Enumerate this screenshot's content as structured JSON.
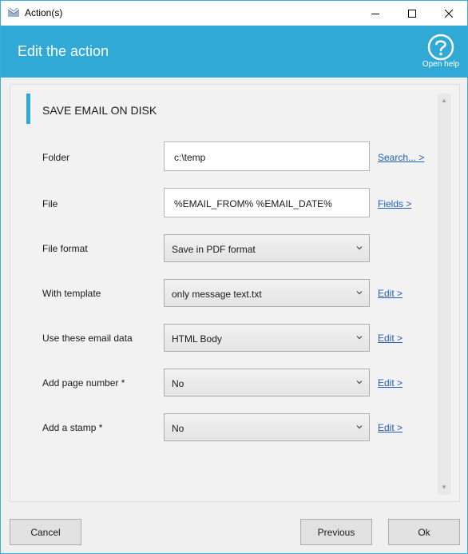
{
  "window": {
    "title": "Action(s)"
  },
  "header": {
    "title": "Edit the action",
    "help_label": "Open help"
  },
  "section": {
    "title": "SAVE EMAIL ON DISK"
  },
  "rows": {
    "folder": {
      "label": "Folder",
      "value": "c:\\temp",
      "link": "Search... >"
    },
    "file": {
      "label": "File",
      "value": "%EMAIL_FROM% %EMAIL_DATE%",
      "link": "Fields >"
    },
    "file_format": {
      "label": "File format",
      "value": "Save in PDF format"
    },
    "template": {
      "label": "With template",
      "value": "only message text.txt",
      "link": "Edit >"
    },
    "email_data": {
      "label": "Use these email data",
      "value": "HTML Body",
      "link": "Edit >"
    },
    "page_number": {
      "label": "Add page number *",
      "value": "No",
      "link": "Edit >"
    },
    "stamp": {
      "label": "Add a stamp *",
      "value": "No",
      "link": "Edit >"
    }
  },
  "buttons": {
    "cancel": "Cancel",
    "previous": "Previous",
    "ok": "Ok"
  },
  "icons": {
    "app": "envelope-icon",
    "help": "question-circle-icon"
  },
  "colors": {
    "accent": "#31a9d6",
    "link": "#1f5fbf"
  }
}
